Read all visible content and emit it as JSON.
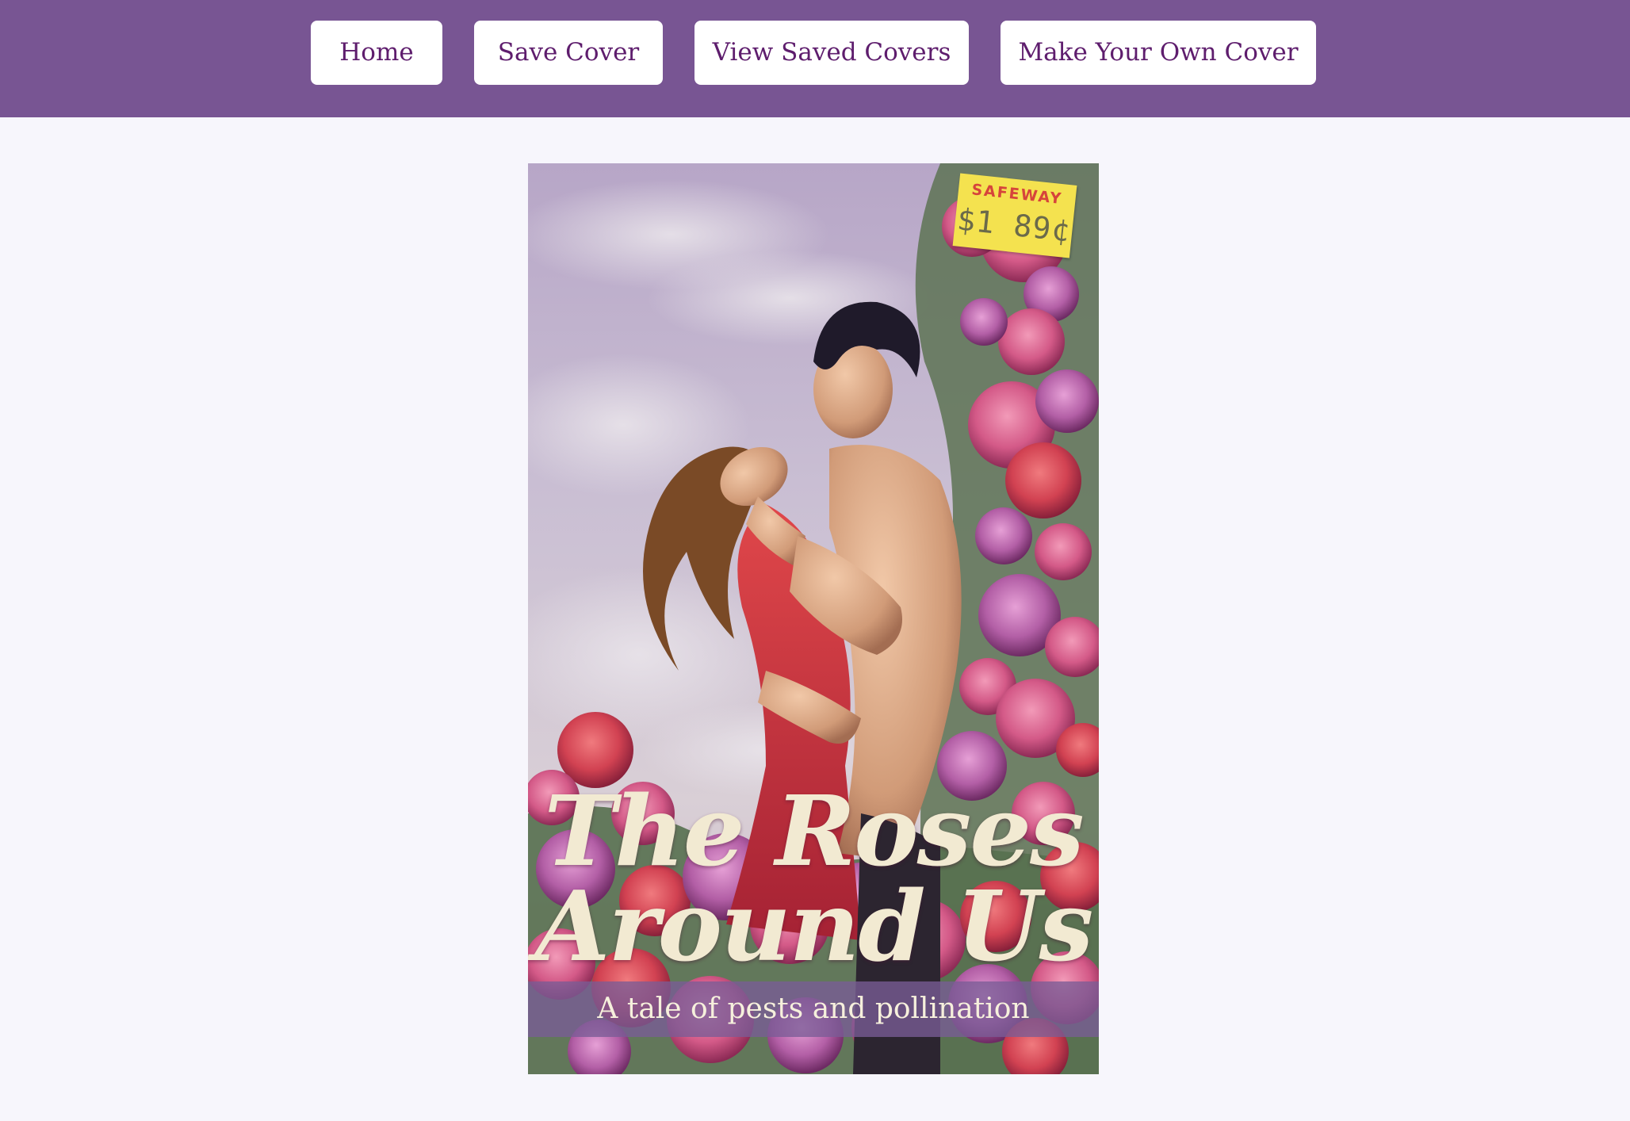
{
  "nav": {
    "home_label": "Home",
    "save_label": "Save Cover",
    "view_saved_label": "View Saved Covers",
    "make_own_label": "Make Your Own Cover"
  },
  "cover": {
    "title": "The Roses Around Us",
    "tagline": "A tale of pests and pollination",
    "price_tag": {
      "store": "SAFEWAY",
      "price": "$1 89¢"
    },
    "image_description_icon": "romance-couple-roses-illustration"
  },
  "colors": {
    "navbar": "#785593",
    "button_text": "#5e1d6d",
    "page_bg": "#f7f6fc",
    "title_text": "#f2ead2"
  }
}
